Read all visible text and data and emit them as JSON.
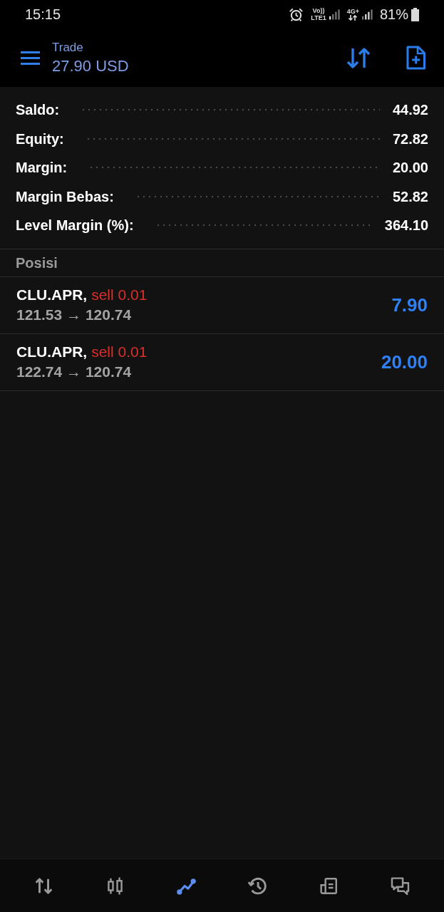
{
  "status_bar": {
    "time": "15:15",
    "volte": "Vo))",
    "lte": "LTE1",
    "network": "4G+",
    "battery": "81%"
  },
  "header": {
    "title": "Trade",
    "balance": "27.90 USD"
  },
  "account": [
    {
      "label": "Saldo:",
      "value": "44.92"
    },
    {
      "label": "Equity:",
      "value": "72.82"
    },
    {
      "label": "Margin:",
      "value": "20.00"
    },
    {
      "label": "Margin Bebas:",
      "value": "52.82"
    },
    {
      "label": "Level Margin (%):",
      "value": "364.10"
    }
  ],
  "positions": {
    "title": "Posisi",
    "items": [
      {
        "symbol": "CLU.APR,",
        "order": "sell 0.01",
        "prices": "121.53 → 120.74",
        "profit": "7.90"
      },
      {
        "symbol": "CLU.APR,",
        "order": "sell 0.01",
        "prices": "122.74 → 120.74",
        "profit": "20.00"
      }
    ]
  },
  "bottom_nav": {
    "items": [
      {
        "selected": false
      },
      {
        "selected": false
      },
      {
        "selected": true
      },
      {
        "selected": false
      },
      {
        "selected": false
      },
      {
        "selected": false
      }
    ]
  }
}
